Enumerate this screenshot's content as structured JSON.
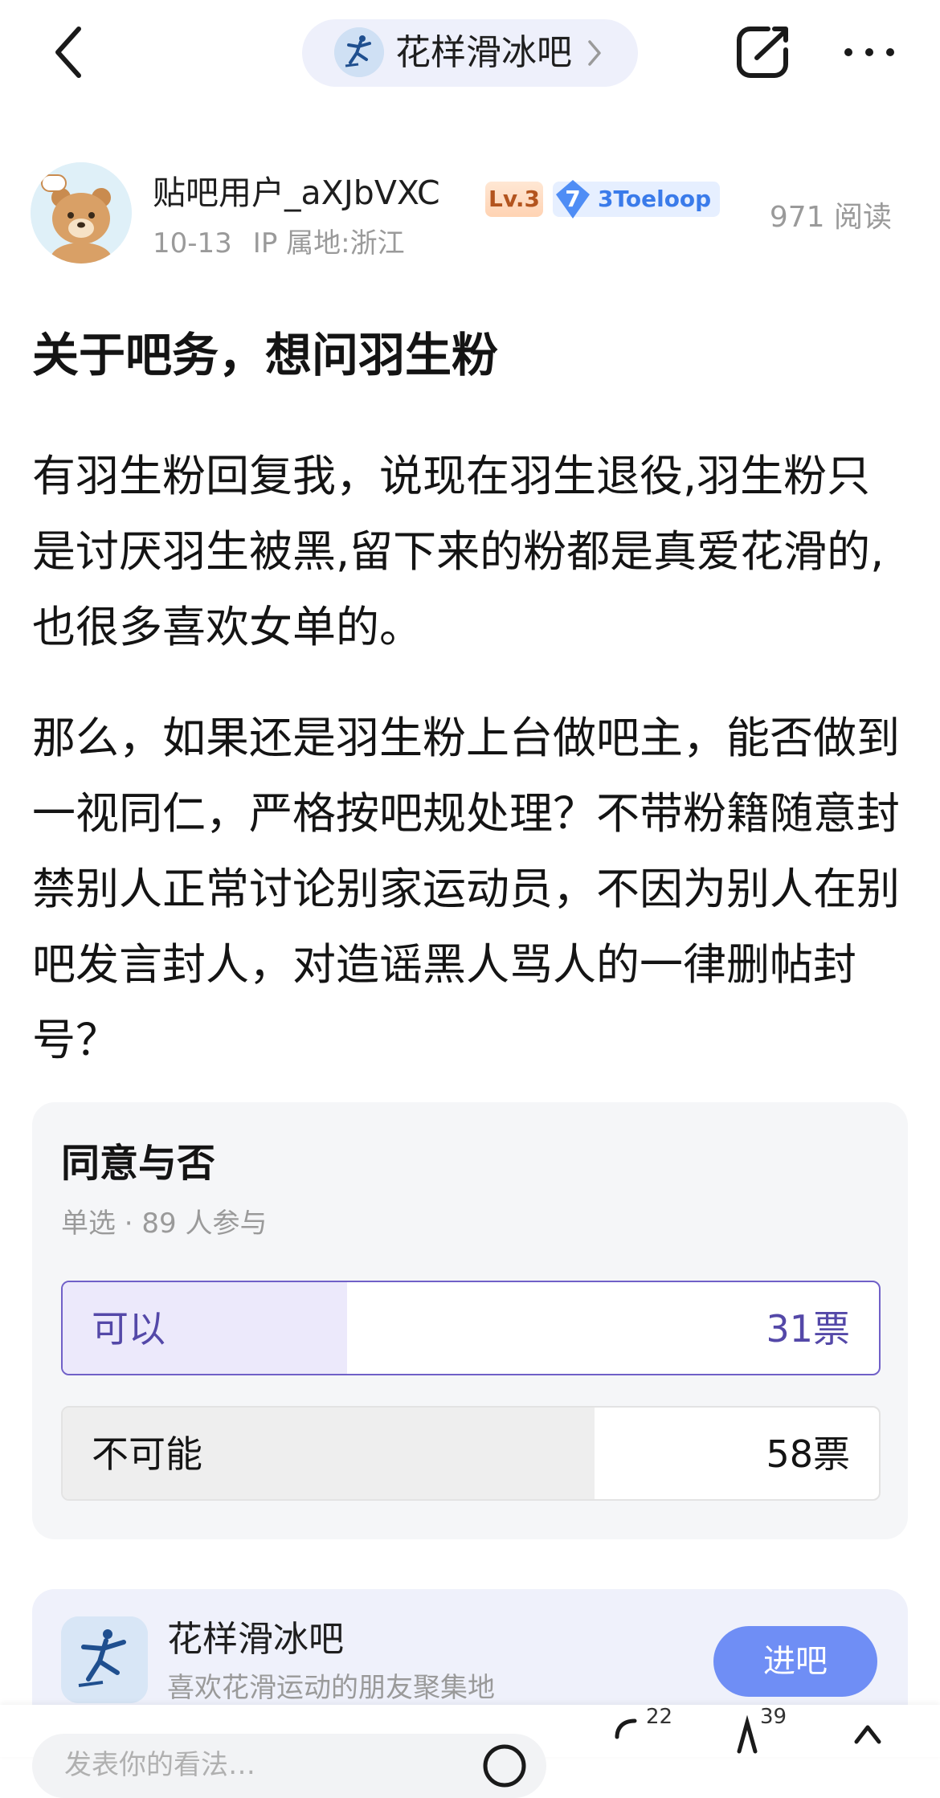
{
  "header": {
    "forum_name": "花样滑冰吧",
    "icons": [
      "back-icon",
      "chevron-right-icon",
      "share-icon",
      "more-icon"
    ]
  },
  "author": {
    "username": "贴吧用户_aXJbVXC",
    "level_badge": "Lv.3",
    "honor_number": "7",
    "honor_title": "3Toeloop",
    "date": "10-13",
    "ip_location": "IP 属地:浙江",
    "read_count": "971 阅读"
  },
  "post": {
    "title": "关于吧务，想问羽生粉",
    "paragraphs": [
      "有羽生粉回复我，说现在羽生退役,羽生粉只是讨厌羽生被黑,留下来的粉都是真爱花滑的,也很多喜欢女单的。",
      "那么，如果还是羽生粉上台做吧主，能否做到一视同仁，严格按吧规处理？不带粉籍随意封禁别人正常讨论别家运动员，不因为别人在别吧发言封人，对造谣黑人骂人的一律删帖封号？"
    ]
  },
  "poll": {
    "title": "同意与否",
    "subtitle": "单选 · 89 人参与",
    "options": [
      {
        "label": "可以",
        "votes": "31票",
        "share": 0.348,
        "selected": true
      },
      {
        "label": "不可能",
        "votes": "58票",
        "share": 0.652,
        "selected": false
      }
    ],
    "accent_color": "#7060c8"
  },
  "forum_card": {
    "name": "花样滑冰吧",
    "description": "喜欢花滑运动的朋友聚集地",
    "join_label": "进吧",
    "join_color": "#6f8ef5"
  },
  "bottom_bar": {
    "reply_placeholder": "发表你的看法…",
    "comment_count": "22",
    "like_count": "39",
    "icons": [
      "emoji-icon",
      "comment-icon",
      "like-icon",
      "share-up-icon"
    ]
  }
}
